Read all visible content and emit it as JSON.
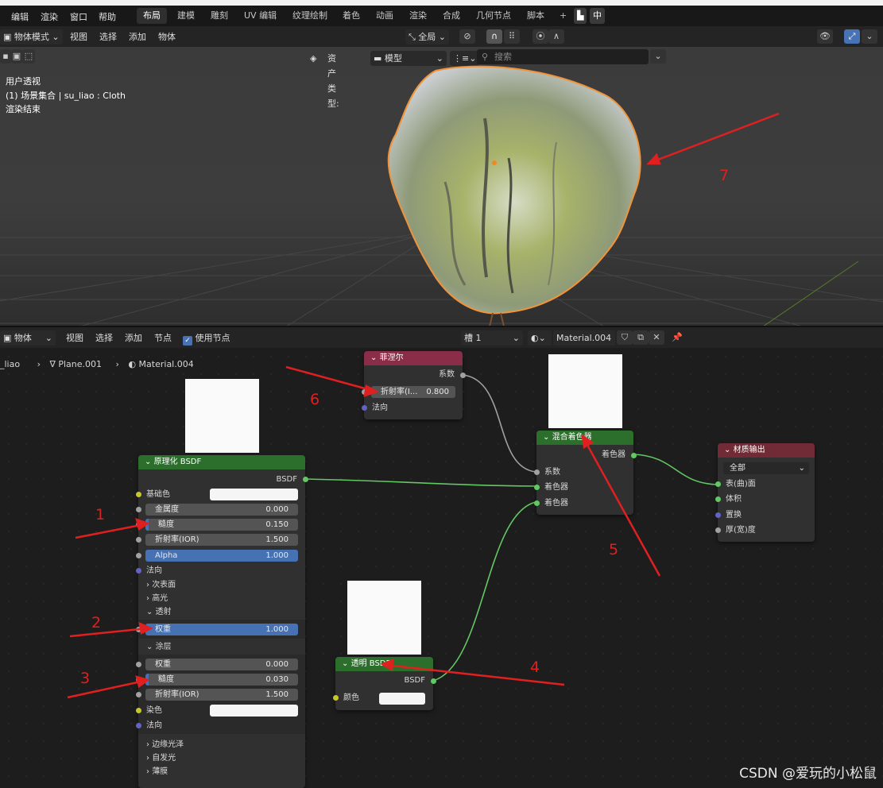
{
  "top_menu": [
    "编辑",
    "渲染",
    "窗口",
    "帮助"
  ],
  "workspace_tabs": [
    "布局",
    "建模",
    "雕刻",
    "UV 编辑",
    "纹理绘制",
    "着色",
    "动画",
    "渲染",
    "合成",
    "几何节点",
    "脚本"
  ],
  "active_tab": "布局",
  "lang_label": "中",
  "viewport_header": {
    "mode": "物体模式",
    "menus": [
      "视图",
      "选择",
      "添加",
      "物体"
    ],
    "transform": "全局"
  },
  "asset_bar": {
    "label": "资产类型:",
    "type": "模型",
    "search_placeholder": "搜索"
  },
  "viewport_info": [
    "用户透视",
    "(1) 场景集合 | su_liao : Cloth",
    "渲染结束"
  ],
  "node_header": {
    "type": "物体",
    "menus": [
      "视图",
      "选择",
      "添加",
      "节点"
    ],
    "use_nodes": "使用节点",
    "slot": "槽 1",
    "material": "Material.004"
  },
  "breadcrumb": [
    "_liao",
    "Plane.001",
    "Material.004"
  ],
  "principled": {
    "title": "原理化 BSDF",
    "output": "BSDF",
    "base_color": "基础色",
    "fields": [
      {
        "label": "金属度",
        "value": "0.000"
      },
      {
        "label": "糙度",
        "value": "0.150"
      },
      {
        "label": "折射率(IOR)",
        "value": "1.500"
      },
      {
        "label": "Alpha",
        "value": "1.000"
      }
    ],
    "normal": "法向",
    "sections": [
      "次表面",
      "高光",
      "透射"
    ],
    "transmission_weight": {
      "label": "权重",
      "value": "1.000"
    },
    "coat_section": "涂层",
    "coat_fields": [
      {
        "label": "权重",
        "value": "0.000"
      },
      {
        "label": "糙度",
        "value": "0.030"
      },
      {
        "label": "折射率(IOR)",
        "value": "1.500"
      }
    ],
    "tint": "染色",
    "coat_normal": "法向",
    "extra_sections": [
      "边缘光泽",
      "自发光",
      "薄膜"
    ]
  },
  "fresnel": {
    "title": "菲涅尔",
    "output": "系数",
    "ior_label": "折射率(I...",
    "ior_value": "0.800",
    "normal": "法向"
  },
  "mix": {
    "title": "混合着色器",
    "output": "着色器",
    "inputs": [
      "系数",
      "着色器",
      "着色器"
    ]
  },
  "transparent": {
    "title": "透明 BSDF",
    "output": "BSDF",
    "color": "颜色"
  },
  "output_node": {
    "title": "材质输出",
    "target": "全部",
    "inputs": [
      "表(曲)面",
      "体积",
      "置换",
      "厚(宽)度"
    ]
  },
  "annotations": [
    "1",
    "2",
    "3",
    "4",
    "5",
    "6",
    "7"
  ],
  "watermark": "CSDN @爱玩的小松鼠"
}
